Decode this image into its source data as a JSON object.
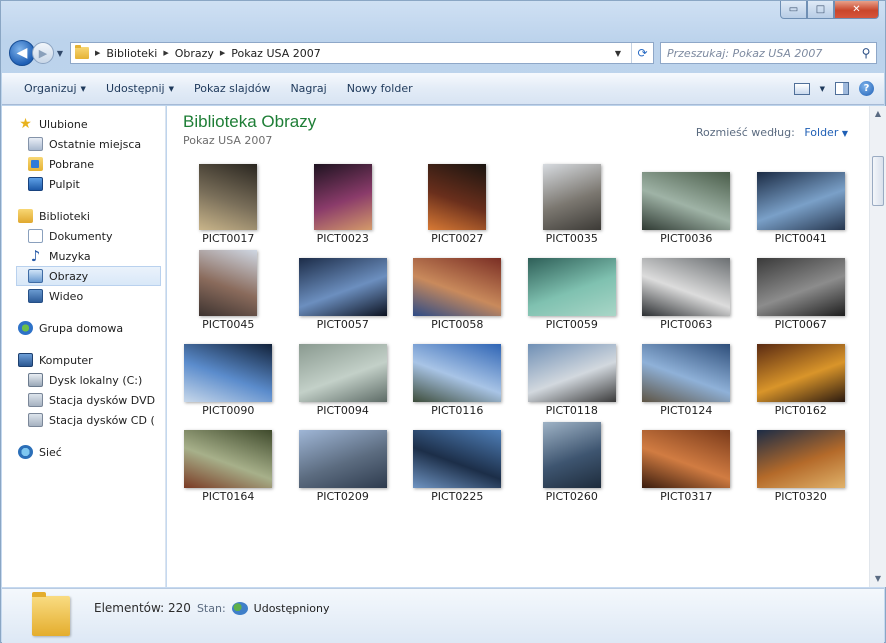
{
  "window": {
    "controls": {
      "minimize": "▭",
      "maximize": "□",
      "close": "✕"
    }
  },
  "address": {
    "crumbs": [
      "Biblioteki",
      "Obrazy",
      "Pokaz USA 2007"
    ]
  },
  "search": {
    "placeholder": "Przeszukaj: Pokaz USA 2007"
  },
  "toolbar": {
    "organize": "Organizuj",
    "share": "Udostępnij",
    "slideshow": "Pokaz slajdów",
    "burn": "Nagraj",
    "new_folder": "Nowy folder"
  },
  "sidebar": {
    "favorites": {
      "label": "Ulubione",
      "items": [
        "Ostatnie miejsca",
        "Pobrane",
        "Pulpit"
      ]
    },
    "libraries": {
      "label": "Biblioteki",
      "items": [
        "Dokumenty",
        "Muzyka",
        "Obrazy",
        "Wideo"
      ],
      "selected": "Obrazy"
    },
    "homegroup": {
      "label": "Grupa domowa"
    },
    "computer": {
      "label": "Komputer",
      "items": [
        "Dysk lokalny (C:)",
        "Stacja dysków DVD",
        "Stacja dysków CD ("
      ]
    },
    "network": {
      "label": "Sieć"
    }
  },
  "library": {
    "title": "Biblioteka Obrazy",
    "subtitle": "Pokaz USA 2007",
    "arrange_label": "Rozmieść według:",
    "arrange_value": "Folder"
  },
  "photos": [
    {
      "name": "PICT0017",
      "colors": [
        "#2a2620",
        "#7a6f5a",
        "#c9b58a"
      ]
    },
    {
      "name": "PICT0023",
      "colors": [
        "#1e1320",
        "#8a3b6a",
        "#d49a6a"
      ]
    },
    {
      "name": "PICT0027",
      "colors": [
        "#1a1410",
        "#6a2f1c",
        "#d87a35"
      ]
    },
    {
      "name": "PICT0035",
      "colors": [
        "#d7dbe0",
        "#7b7770",
        "#3c3a36"
      ]
    },
    {
      "name": "PICT0036",
      "colors": [
        "#4a5d4a",
        "#9fb3a6",
        "#2f3a33"
      ]
    },
    {
      "name": "PICT0041",
      "colors": [
        "#1b2b44",
        "#7aa0c8",
        "#26364e"
      ]
    },
    {
      "name": "PICT0045",
      "colors": [
        "#cfd7e3",
        "#8a6b5c",
        "#3d3330"
      ]
    },
    {
      "name": "PICT0057",
      "colors": [
        "#1c2c48",
        "#6c8fbf",
        "#0c1220"
      ]
    },
    {
      "name": "PICT0058",
      "colors": [
        "#7a2e24",
        "#c98a5c",
        "#2d4b86"
      ]
    },
    {
      "name": "PICT0059",
      "colors": [
        "#2e5f58",
        "#7fc1b0",
        "#a9d6c7"
      ]
    },
    {
      "name": "PICT0063",
      "colors": [
        "#6b6f72",
        "#dcdcdc",
        "#2b2e31"
      ]
    },
    {
      "name": "PICT0067",
      "colors": [
        "#3a3a3a",
        "#8c8c8c",
        "#1e1e1e"
      ]
    },
    {
      "name": "PICT0090",
      "colors": [
        "#12223a",
        "#5b8ccc",
        "#c8d8ea"
      ]
    },
    {
      "name": "PICT0094",
      "colors": [
        "#8a9a90",
        "#c3d0c8",
        "#5d6b66"
      ]
    },
    {
      "name": "PICT0116",
      "colors": [
        "#2f65b5",
        "#a8c4e6",
        "#3d4c3a"
      ]
    },
    {
      "name": "PICT0118",
      "colors": [
        "#6f8fb5",
        "#d2d8de",
        "#3a3a3a"
      ]
    },
    {
      "name": "PICT0124",
      "colors": [
        "#2e4e7a",
        "#8fb1d8",
        "#5e5444"
      ]
    },
    {
      "name": "PICT0162",
      "colors": [
        "#5a2a12",
        "#d9952a",
        "#2b1a10"
      ]
    },
    {
      "name": "PICT0164",
      "colors": [
        "#3f4a2c",
        "#a7b08a",
        "#7a3a24"
      ]
    },
    {
      "name": "PICT0209",
      "colors": [
        "#9fb6d6",
        "#5c6c80",
        "#2e3b4e"
      ]
    },
    {
      "name": "PICT0225",
      "colors": [
        "#4f7fb8",
        "#1c2e48",
        "#6f94c2"
      ]
    },
    {
      "name": "PICT0260",
      "colors": [
        "#9fb3c6",
        "#3e5570",
        "#1e2c3c"
      ]
    },
    {
      "name": "PICT0317",
      "colors": [
        "#7a3a1a",
        "#d17c42",
        "#3a1c0e"
      ]
    },
    {
      "name": "PICT0320",
      "colors": [
        "#1c2c46",
        "#b46a2a",
        "#e0b26a"
      ]
    }
  ],
  "status": {
    "count": "Elementów: 220",
    "state_label": "Stan:",
    "state_value": "Udostępniony"
  }
}
